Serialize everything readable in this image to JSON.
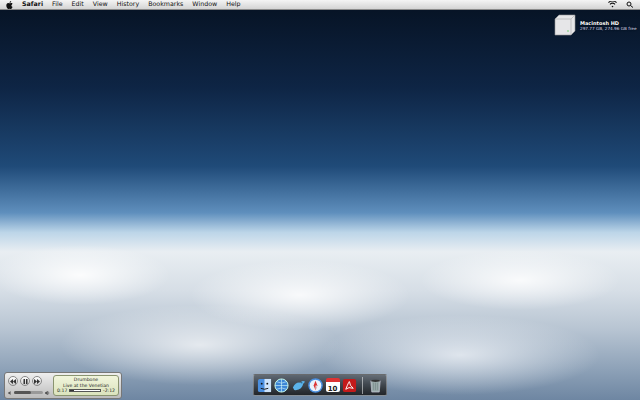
{
  "menubar": {
    "app": "Safari",
    "menus": [
      "File",
      "Edit",
      "View",
      "History",
      "Bookmarks",
      "Window",
      "Help"
    ]
  },
  "desktop_icons": [
    {
      "name": "Macintosh HD",
      "info": "297.77 GB, 274.96 GB free",
      "selected": false
    }
  ],
  "player": {
    "title": "Drumbone",
    "album": "Live at the Venetian",
    "elapsed": "0:17",
    "remaining": "-2:12",
    "progress": 0.12,
    "volume": 0.6,
    "playing": true
  },
  "dock": [
    {
      "kind": "finder"
    },
    {
      "kind": "globe"
    },
    {
      "kind": "twitter"
    },
    {
      "kind": "safari"
    },
    {
      "kind": "calendar",
      "text": "10"
    },
    {
      "kind": "reader"
    },
    {
      "kind": "separator"
    },
    {
      "kind": "trash"
    }
  ]
}
